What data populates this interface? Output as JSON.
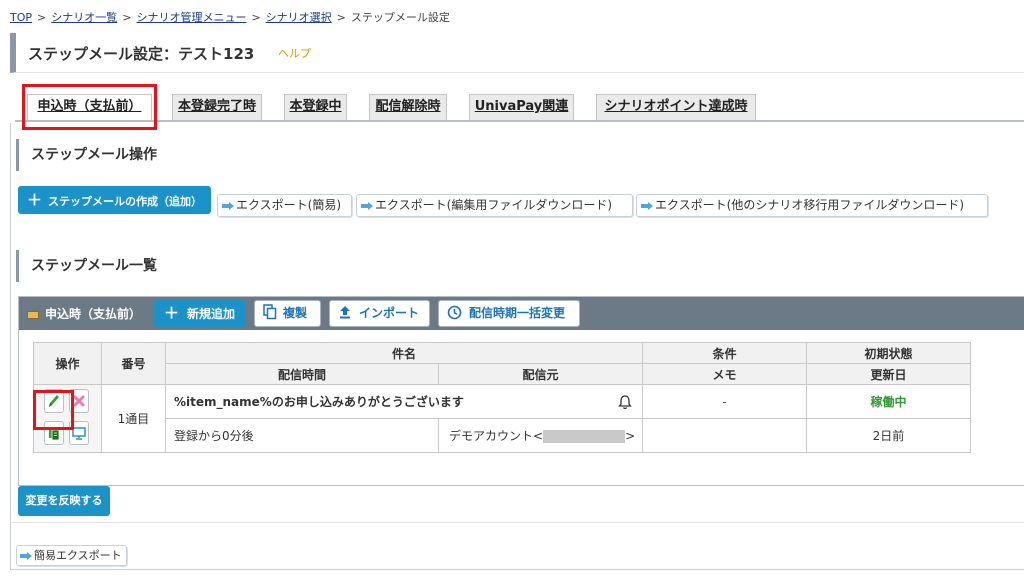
{
  "breadcrumb": {
    "items": [
      "TOP",
      "シナリオ一覧",
      "シナリオ管理メニュー",
      "シナリオ選択"
    ],
    "current": "ステップメール設定",
    "separator": ">"
  },
  "header": {
    "title": "ステップメール設定：テスト123",
    "help": "ヘルプ"
  },
  "tabs": [
    "申込時（支払前）",
    "本登録完了時",
    "本登録中",
    "配信解除時",
    "UnivaPay関連",
    "シナリオポイント達成時"
  ],
  "operations": {
    "title": "ステップメール操作",
    "create_button": "ステップメールの作成（追加）",
    "export_simple": "エクスポート(簡易)",
    "export_edit": "エクスポート(編集用ファイルダウンロード)",
    "export_migrate": "エクスポート(他のシナリオ移行用ファイルダウンロード)"
  },
  "list": {
    "title": "ステップメール一覧",
    "panel_label": "申込時（支払前）",
    "buttons": {
      "add": "新規追加",
      "copy": "複製",
      "import": "インポート",
      "bulk_change": "配信時期一括変更"
    },
    "headers": {
      "op": "操作",
      "number": "番号",
      "subject": "件名",
      "condition": "条件",
      "initial_status": "初期状態",
      "delivery_time": "配信時間",
      "sender": "配信元",
      "memo": "メモ",
      "updated": "更新日"
    },
    "row": {
      "number": "1通目",
      "subject": "%item_name%のお申し込みありがとうございます",
      "condition": "-",
      "status": "稼働中",
      "delivery_time": "登録から0分後",
      "sender_prefix": "デモアカウント<",
      "sender_suffix": ">",
      "updated": "2日前"
    }
  },
  "apply_button": "変更を反映する",
  "simple_export_button": "簡易エクスポート",
  "colors": {
    "primary": "#1b93c8",
    "highlight": "#e0141d",
    "panel_bar": "#6c7a88",
    "status_active": "#2f9a2f",
    "help": "#d59a00"
  }
}
